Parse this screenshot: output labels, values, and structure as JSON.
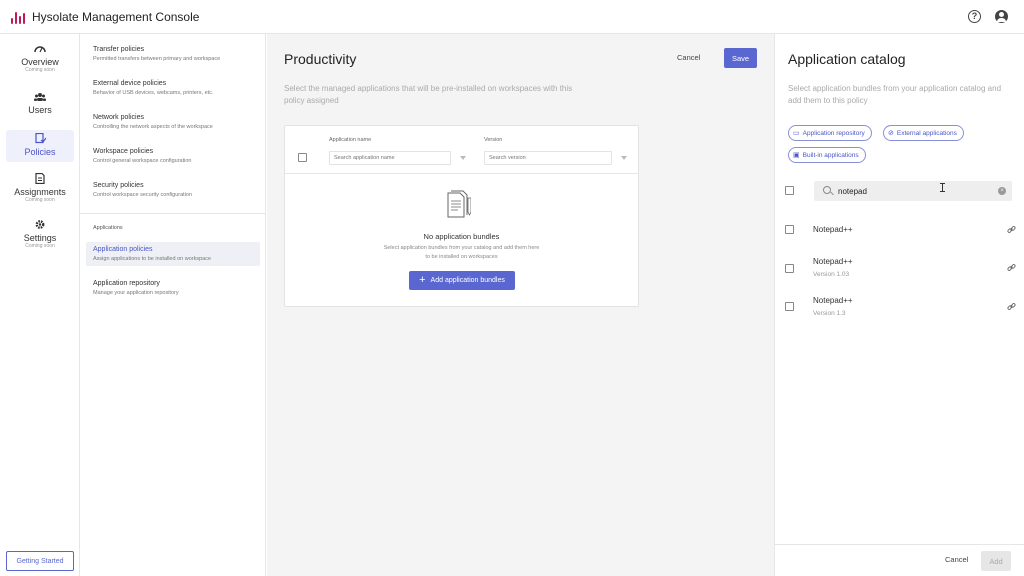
{
  "app": {
    "title": "Hysolate Management Console"
  },
  "header_icons": {
    "help": "?",
    "user": "user-circle"
  },
  "nav": {
    "items": [
      {
        "label": "Overview",
        "sub": "Coming soon",
        "icon": "gauge-icon"
      },
      {
        "label": "Users",
        "sub": "",
        "icon": "users-icon"
      },
      {
        "label": "Policies",
        "sub": "",
        "icon": "policies-icon"
      },
      {
        "label": "Assignments",
        "sub": "Coming soon",
        "icon": "document-icon"
      },
      {
        "label": "Settings",
        "sub": "Coming soon",
        "icon": "gear-icon"
      }
    ],
    "getting_started": "Getting Started"
  },
  "policy_list": {
    "items": [
      {
        "title": "Transfer policies",
        "desc": "Permitted transfers between primary and workspace"
      },
      {
        "title": "External device policies",
        "desc": "Behavior of USB devices, webcams, printers, etc."
      },
      {
        "title": "Network policies",
        "desc": "Controlling the network aspects of the workspace"
      },
      {
        "title": "Workspace policies",
        "desc": "Control general workspace configuration"
      },
      {
        "title": "Security policies",
        "desc": "Control workspace security configuration"
      }
    ],
    "section": "Applications",
    "app_items": [
      {
        "title": "Application policies",
        "desc": "Assign applications to be installed on workspace"
      },
      {
        "title": "Application repository",
        "desc": "Manage your application repository"
      }
    ]
  },
  "main": {
    "title": "Productivity",
    "cancel": "Cancel",
    "save": "Save",
    "description": "Select the managed applications that will be pre-installed on workspaces with this policy assigned",
    "table": {
      "col_name": "Application name",
      "col_version": "Version",
      "name_placeholder": "Search application name",
      "version_placeholder": "Search version"
    },
    "empty": {
      "title": "No application bundles",
      "desc": "Select application bundles from your catalog and add them here to be installed on workspaces",
      "button": "Add application bundles"
    }
  },
  "catalog": {
    "title": "Application catalog",
    "description": "Select application bundles from your application catalog and add them to this policy",
    "chips": [
      {
        "label": "Application repository",
        "icon": "folder-icon"
      },
      {
        "label": "External applications",
        "icon": "link-icon"
      },
      {
        "label": "Built-in applications",
        "icon": "window-icon"
      }
    ],
    "search_value": "notepad",
    "results": [
      {
        "name": "Notepad++",
        "version": ""
      },
      {
        "name": "Notepad++",
        "version": "Version 1.03"
      },
      {
        "name": "Notepad++",
        "version": "Version 1.3"
      }
    ],
    "cancel": "Cancel",
    "add": "Add"
  },
  "colors": {
    "accent": "#5b67d0",
    "brand": "#c2185b"
  }
}
